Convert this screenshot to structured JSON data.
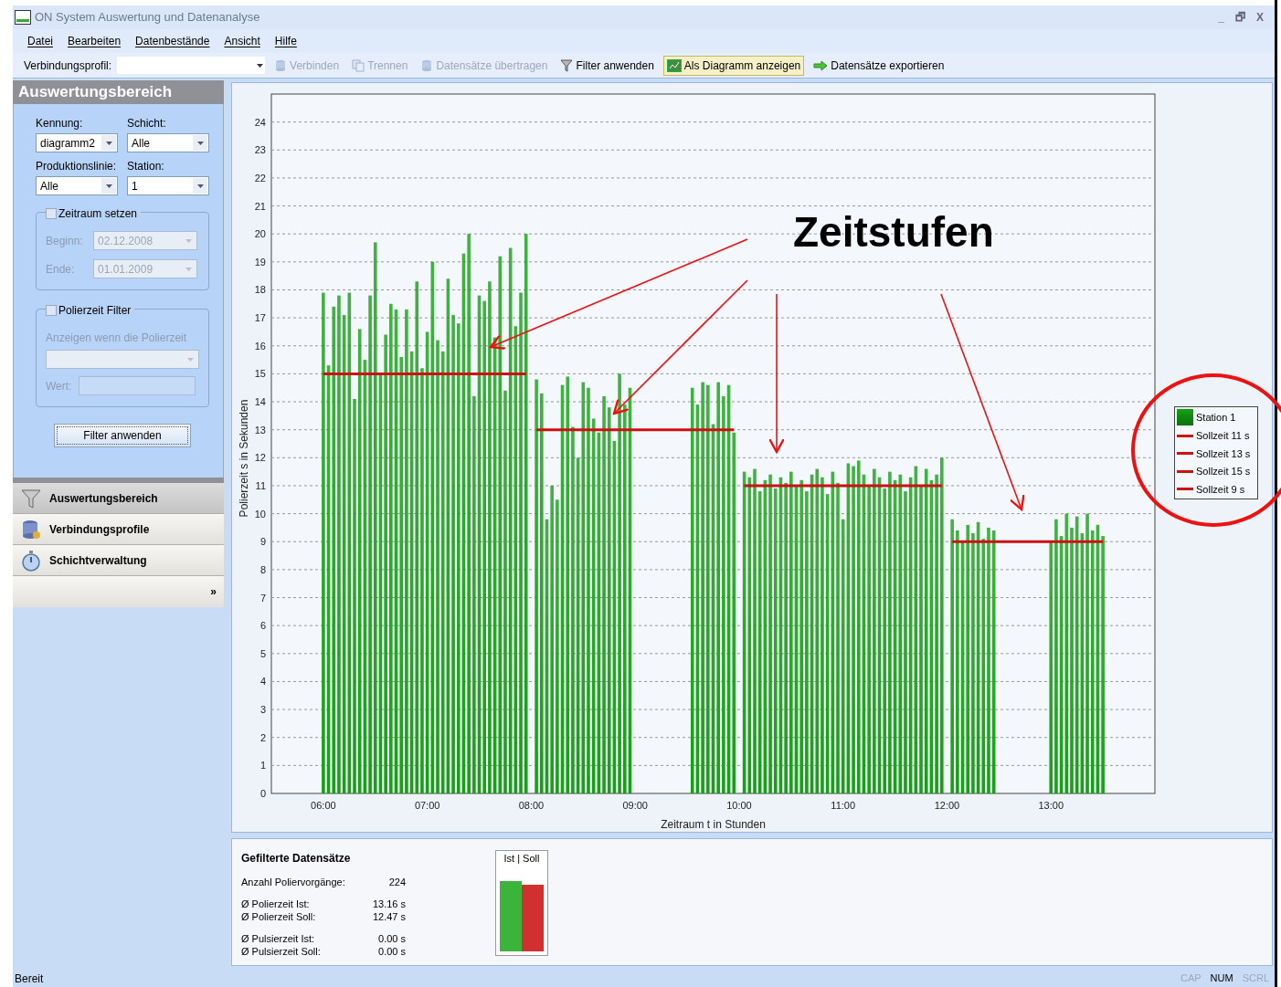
{
  "window": {
    "title": "ON System Auswertung und Datenanalyse",
    "controls": [
      "_",
      "🗗",
      "X"
    ]
  },
  "menu": [
    {
      "label": "Datei"
    },
    {
      "label": "Bearbeiten"
    },
    {
      "label": "Datenbestände"
    },
    {
      "label": "Ansicht"
    },
    {
      "label": "Hilfe"
    }
  ],
  "toolbar": {
    "profile_label": "Verbindungsprofil:",
    "buttons": [
      {
        "label": "Verbinden",
        "disabled": true,
        "selected": false
      },
      {
        "label": "Trennen",
        "disabled": true,
        "selected": false
      },
      {
        "label": "Datensätze übertragen",
        "disabled": true,
        "selected": false
      },
      {
        "label": "Filter anwenden",
        "disabled": false,
        "selected": false
      },
      {
        "label": "Als Diagramm anzeigen",
        "disabled": false,
        "selected": true
      },
      {
        "label": "Datensätze exportieren",
        "disabled": false,
        "selected": false
      }
    ]
  },
  "sidebar": {
    "title": "Auswertungsbereich",
    "fields": [
      {
        "label": "Kennung:",
        "value": "diagramm2"
      },
      {
        "label": "Schicht:",
        "value": "Alle"
      },
      {
        "label": "Produktionslinie:",
        "value": "Alle"
      },
      {
        "label": "Station:",
        "value": "1"
      }
    ],
    "period": {
      "label": "Zeitraum setzen",
      "checked": false,
      "begin_label": "Beginn:",
      "begin": "02.12.2008",
      "end_label": "Ende:",
      "end": "01.01.2009"
    },
    "filter": {
      "label": "Polierzeit Filter",
      "checked": false,
      "hint": "Anzeigen wenn die Polierzeit",
      "value_label": "Wert:"
    },
    "apply_button": "Filter anwenden",
    "nav": [
      {
        "label": "Auswertungsbereich",
        "selected": true
      },
      {
        "label": "Verbindungsprofile",
        "selected": false
      },
      {
        "label": "Schichtverwaltung",
        "selected": false
      }
    ],
    "more": "»"
  },
  "chart": {
    "chart_data": {
      "type": "bar",
      "xlabel": "Zeitraum t in Stunden",
      "ylabel": "Polierzeit s in Sekunden",
      "grid": true,
      "x": [
        6.0,
        6.05,
        6.1,
        6.15,
        6.2,
        6.25,
        6.3,
        6.35,
        6.4,
        6.45,
        6.5,
        6.55,
        6.6,
        6.65,
        6.7,
        6.75,
        6.8,
        6.85,
        6.9,
        6.95,
        7.0,
        7.05,
        7.1,
        7.15,
        7.2,
        7.25,
        7.3,
        7.35,
        7.4,
        7.45,
        7.5,
        7.55,
        7.6,
        7.65,
        7.7,
        7.75,
        7.8,
        7.85,
        7.9,
        7.95,
        8.05,
        8.1,
        8.15,
        8.2,
        8.25,
        8.3,
        8.35,
        8.4,
        8.45,
        8.5,
        8.55,
        8.6,
        8.65,
        8.7,
        8.75,
        8.8,
        8.85,
        8.9,
        8.95,
        9.55,
        9.6,
        9.65,
        9.7,
        9.75,
        9.8,
        9.85,
        9.9,
        9.95,
        10.05,
        10.1,
        10.15,
        10.2,
        10.25,
        10.3,
        10.35,
        10.4,
        10.45,
        10.5,
        10.55,
        10.6,
        10.65,
        10.7,
        10.75,
        10.8,
        10.85,
        10.9,
        10.95,
        11.0,
        11.05,
        11.1,
        11.15,
        11.2,
        11.25,
        11.3,
        11.35,
        11.4,
        11.45,
        11.5,
        11.55,
        11.6,
        11.65,
        11.7,
        11.75,
        11.8,
        11.85,
        11.9,
        11.95,
        12.05,
        12.1,
        12.15,
        12.2,
        12.25,
        12.3,
        12.35,
        12.4,
        12.45,
        13.0,
        13.05,
        13.1,
        13.15,
        13.2,
        13.25,
        13.3,
        13.35,
        13.4,
        13.45,
        13.5
      ],
      "series": [
        {
          "name": "Station 1",
          "type": "bar",
          "color": "#16a016",
          "values": [
            17.9,
            15.3,
            17.4,
            17.8,
            17.1,
            17.9,
            14.1,
            16.6,
            15.5,
            17.8,
            19.7,
            15.0,
            16.4,
            17.5,
            17.3,
            15.6,
            17.3,
            15.8,
            18.3,
            15.2,
            16.5,
            19.0,
            16.2,
            15.8,
            18.4,
            17.1,
            16.8,
            19.3,
            20.0,
            14.2,
            17.8,
            17.6,
            18.3,
            16.3,
            19.2,
            14.4,
            19.5,
            16.7,
            17.9,
            20.0,
            14.8,
            14.3,
            9.8,
            11.0,
            10.5,
            14.6,
            14.9,
            13.1,
            12.0,
            14.7,
            14.5,
            13.4,
            12.9,
            14.2,
            13.8,
            12.6,
            15.0,
            13.9,
            14.5,
            14.5,
            13.9,
            14.7,
            14.6,
            13.2,
            14.7,
            14.2,
            14.6,
            12.9,
            11.5,
            11.3,
            11.6,
            10.8,
            11.2,
            11.4,
            10.9,
            11.3,
            11.1,
            11.5,
            11.0,
            11.2,
            10.8,
            11.4,
            11.6,
            11.3,
            10.7,
            11.5,
            11.1,
            9.8,
            11.8,
            11.7,
            11.9,
            11.4,
            11.0,
            11.6,
            11.3,
            10.9,
            11.5,
            11.2,
            11.4,
            10.8,
            11.3,
            11.7,
            11.0,
            11.6,
            11.2,
            11.4,
            12.0,
            9.8,
            9.4,
            9.0,
            9.6,
            9.3,
            9.7,
            9.1,
            9.5,
            9.4,
            9.0,
            9.8,
            9.2,
            10.0,
            9.5,
            9.9,
            9.3,
            10.0,
            9.4,
            9.6,
            9.2
          ]
        },
        {
          "name": "Sollzeit 11 s",
          "type": "line",
          "color": "#cc1111",
          "values": [
            null,
            null,
            null,
            null,
            null,
            null,
            null,
            null,
            null,
            null,
            null,
            null,
            null,
            null,
            null,
            null,
            null,
            null,
            null,
            null,
            null,
            null,
            null,
            null,
            null,
            null,
            null,
            null,
            null,
            null,
            null,
            null,
            null,
            null,
            null,
            null,
            null,
            null,
            null,
            null,
            null,
            null,
            null,
            null,
            null,
            null,
            null,
            null,
            null,
            null,
            null,
            null,
            null,
            null,
            null,
            null,
            null,
            null,
            null,
            null,
            null,
            null,
            null,
            null,
            null,
            null,
            null,
            null,
            11,
            11,
            11,
            11,
            11,
            11,
            11,
            11,
            11,
            11,
            11,
            11,
            11,
            11,
            11,
            11,
            11,
            11,
            11,
            11,
            11,
            11,
            11,
            11,
            11,
            11,
            11,
            11,
            11,
            11,
            11,
            11,
            11,
            11,
            11,
            11,
            11,
            11,
            11,
            null,
            null,
            null,
            null,
            null,
            null,
            null,
            null,
            null,
            null,
            null,
            null,
            null,
            null,
            null,
            null,
            null,
            null,
            null,
            null
          ]
        },
        {
          "name": "Sollzeit 13 s",
          "type": "line",
          "color": "#cc1111",
          "values": [
            null,
            null,
            null,
            null,
            null,
            null,
            null,
            null,
            null,
            null,
            null,
            null,
            null,
            null,
            null,
            null,
            null,
            null,
            null,
            null,
            null,
            null,
            null,
            null,
            null,
            null,
            null,
            null,
            null,
            null,
            null,
            null,
            null,
            null,
            null,
            null,
            null,
            null,
            null,
            null,
            13,
            13,
            13,
            13,
            13,
            13,
            13,
            13,
            13,
            13,
            13,
            13,
            13,
            13,
            13,
            13,
            13,
            13,
            13,
            13,
            13,
            13,
            13,
            13,
            13,
            13,
            13,
            13,
            null,
            null,
            null,
            null,
            null,
            null,
            null,
            null,
            null,
            null,
            null,
            null,
            null,
            null,
            null,
            null,
            null,
            null,
            null,
            null,
            null,
            null,
            null,
            null,
            null,
            null,
            null,
            null,
            null,
            null,
            null,
            null,
            null,
            null,
            null,
            null,
            null,
            null,
            null,
            null,
            null,
            null,
            null,
            null,
            null,
            null,
            null,
            null,
            null,
            null,
            null,
            null,
            null,
            null,
            null,
            null,
            null,
            null,
            null
          ]
        },
        {
          "name": "Sollzeit 15 s",
          "type": "line",
          "color": "#cc1111",
          "values": [
            15,
            15,
            15,
            15,
            15,
            15,
            15,
            15,
            15,
            15,
            15,
            15,
            15,
            15,
            15,
            15,
            15,
            15,
            15,
            15,
            15,
            15,
            15,
            15,
            15,
            15,
            15,
            15,
            15,
            15,
            15,
            15,
            15,
            15,
            15,
            15,
            15,
            15,
            15,
            15,
            null,
            null,
            null,
            null,
            null,
            null,
            null,
            null,
            null,
            null,
            null,
            null,
            null,
            null,
            null,
            null,
            null,
            null,
            null,
            null,
            null,
            null,
            null,
            null,
            null,
            null,
            null,
            null,
            null,
            null,
            null,
            null,
            null,
            null,
            null,
            null,
            null,
            null,
            null,
            null,
            null,
            null,
            null,
            null,
            null,
            null,
            null,
            null,
            null,
            null,
            null,
            null,
            null,
            null,
            null,
            null,
            null,
            null,
            null,
            null,
            null,
            null,
            null,
            null,
            null,
            null,
            null,
            null,
            null,
            null,
            null,
            null,
            null,
            null,
            null,
            null,
            null,
            null,
            null,
            null,
            null,
            null,
            null,
            null,
            null,
            null,
            null
          ]
        },
        {
          "name": "Sollzeit 9 s",
          "type": "line",
          "color": "#cc1111",
          "values": [
            null,
            null,
            null,
            null,
            null,
            null,
            null,
            null,
            null,
            null,
            null,
            null,
            null,
            null,
            null,
            null,
            null,
            null,
            null,
            null,
            null,
            null,
            null,
            null,
            null,
            null,
            null,
            null,
            null,
            null,
            null,
            null,
            null,
            null,
            null,
            null,
            null,
            null,
            null,
            null,
            null,
            null,
            null,
            null,
            null,
            null,
            null,
            null,
            null,
            null,
            null,
            null,
            null,
            null,
            null,
            null,
            null,
            null,
            null,
            null,
            null,
            null,
            null,
            null,
            null,
            null,
            null,
            null,
            null,
            null,
            null,
            null,
            null,
            null,
            null,
            null,
            null,
            null,
            null,
            null,
            null,
            null,
            null,
            null,
            null,
            null,
            null,
            null,
            null,
            null,
            null,
            null,
            null,
            null,
            null,
            null,
            null,
            null,
            null,
            null,
            null,
            null,
            null,
            null,
            null,
            null,
            null,
            9,
            9,
            9,
            9,
            9,
            9,
            9,
            9,
            9,
            9,
            9,
            9,
            9,
            9,
            9,
            9,
            9,
            9,
            9,
            9
          ]
        }
      ],
      "xlim": [
        5.5,
        14
      ],
      "ylim": [
        0,
        25
      ],
      "xticks": [
        {
          "value": 6,
          "label": "06:00"
        },
        {
          "value": 7,
          "label": "07:00"
        },
        {
          "value": 8,
          "label": "08:00"
        },
        {
          "value": 9,
          "label": "09:00"
        },
        {
          "value": 10,
          "label": "10:00"
        },
        {
          "value": 11,
          "label": "11:00"
        },
        {
          "value": 12,
          "label": "12:00"
        },
        {
          "value": 13,
          "label": "13:00"
        }
      ],
      "yticks": [
        0,
        1,
        2,
        3,
        4,
        5,
        6,
        7,
        8,
        9,
        10,
        11,
        12,
        13,
        14,
        15,
        16,
        17,
        18,
        19,
        20,
        21,
        22,
        23,
        24
      ]
    }
  },
  "stats": {
    "title": "Gefilterte Datensätze",
    "groups": [
      [
        {
          "label": "Anzahl Poliervorgänge:",
          "value": "224"
        }
      ],
      [
        {
          "label": "Ø Polierzeit Ist:",
          "value": "13.16 s"
        },
        {
          "label": "Ø Polierzeit Soll:",
          "value": "12.47 s"
        }
      ],
      [
        {
          "label": "Ø Pulsierzeit Ist:",
          "value": "0.00 s"
        },
        {
          "label": "Ø Pulsierzeit Soll:",
          "value": "0.00 s"
        }
      ]
    ],
    "mini_chart_title": "Ist | Soll"
  },
  "annotation": {
    "label": "Zeitstufen"
  },
  "status_bar": {
    "text": "Bereit",
    "indicators": [
      {
        "label": "CAP",
        "on": false
      },
      {
        "label": "NUM",
        "on": true
      },
      {
        "label": "SCRL",
        "on": false
      }
    ]
  }
}
